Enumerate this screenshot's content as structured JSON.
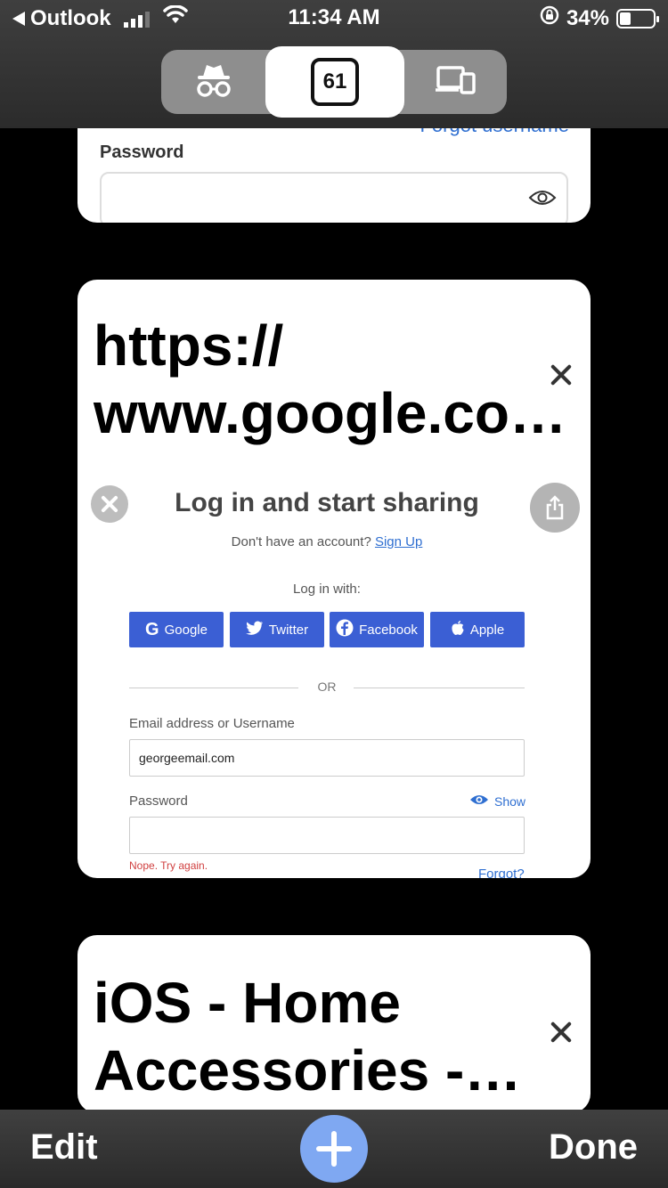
{
  "status_bar": {
    "back_app": "Outlook",
    "time": "11:34 AM",
    "battery": "34%"
  },
  "tab_switcher": {
    "private_icon": "incognito-icon",
    "tab_count": "61",
    "devices_icon": "devices-icon"
  },
  "card_top": {
    "forgot_link": "Forgot username",
    "password_label": "Password"
  },
  "card_main": {
    "title": "https:// www.google.co…",
    "preview": {
      "heading": "Log in and start sharing",
      "no_account": "Don't have an account?",
      "sign_up": "Sign Up",
      "log_in_with": "Log in with:",
      "buttons": [
        "Google",
        "Twitter",
        "Facebook",
        "Apple"
      ],
      "or": "OR",
      "email_label": "Email address or Username",
      "email_value": "georgeemail.com",
      "password_label": "Password",
      "show": "Show",
      "error": "Nope. Try again.",
      "forgot": "Forgot?"
    }
  },
  "card_bottom": {
    "title": "iOS - Home Accessories -…"
  },
  "toolbar": {
    "edit": "Edit",
    "done": "Done"
  },
  "colors": {
    "accent_blue": "#2f6fd1",
    "social_button": "#3b5fd4",
    "plus_button": "#7fa8f2",
    "error_red": "#d04040"
  }
}
